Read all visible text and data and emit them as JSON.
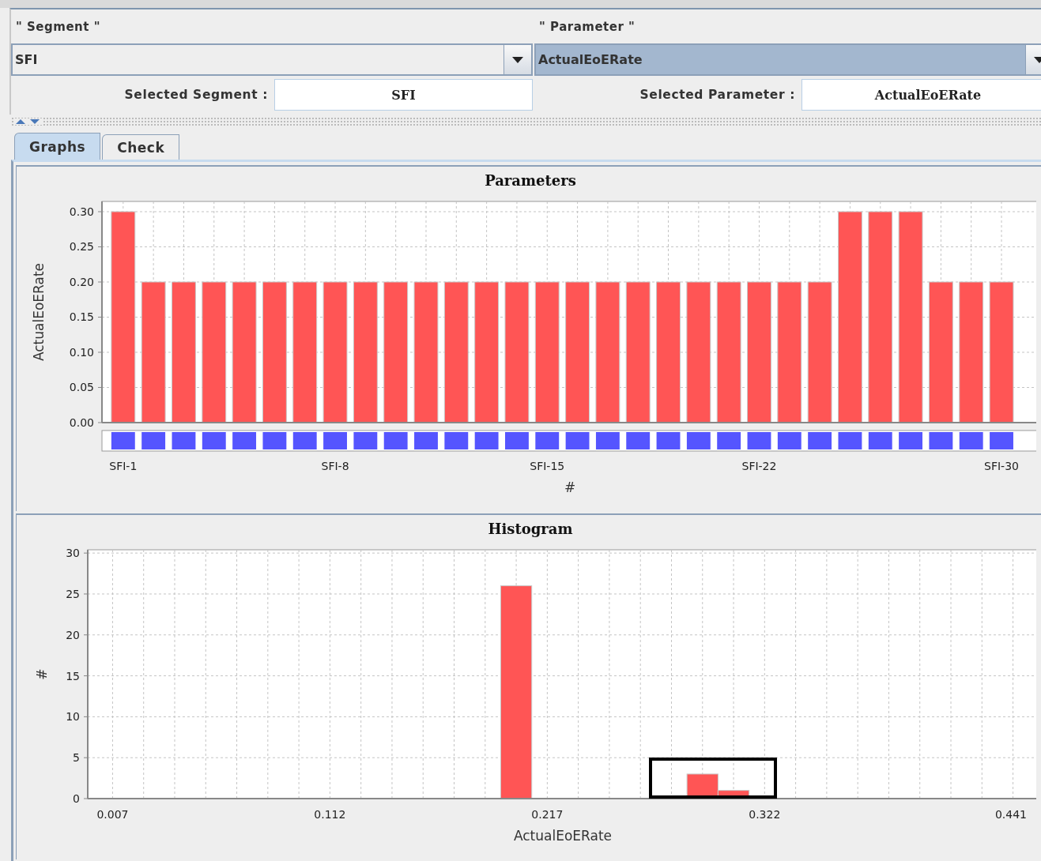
{
  "fields": [
    {
      "label": "\" Segment \"",
      "value": "SFI",
      "highlighted": false,
      "selected_label": "Selected Segment :",
      "selected_value": "SFI"
    },
    {
      "label": "\" Parameter \"",
      "value": "ActualEoERate",
      "highlighted": true,
      "selected_label": "Selected Parameter :",
      "selected_value": "ActualEoERate"
    }
  ],
  "tabs": [
    {
      "label": "Graphs",
      "selected": true
    },
    {
      "label": "Check",
      "selected": false
    }
  ],
  "charts": [
    {
      "chart_data": {
        "type": "bar",
        "title": "Parameters",
        "xlabel": "#",
        "ylabel": "ActualEoERate",
        "grid": true,
        "categories": [
          "SFI-1",
          null,
          null,
          null,
          null,
          null,
          null,
          "SFI-8",
          null,
          null,
          null,
          null,
          null,
          null,
          "SFI-15",
          null,
          null,
          null,
          null,
          null,
          null,
          "SFI-22",
          null,
          null,
          null,
          null,
          null,
          null,
          null,
          "SFI-30"
        ],
        "series": [
          {
            "color": "#ff5555",
            "values": [
              0.3,
              0.2,
              0.2,
              0.2,
              0.2,
              0.2,
              0.2,
              0.2,
              0.2,
              0.2,
              0.2,
              0.2,
              0.2,
              0.2,
              0.2,
              0.2,
              0.2,
              0.2,
              0.2,
              0.2,
              0.2,
              0.2,
              0.2,
              0.2,
              0.3,
              0.3,
              0.3,
              0.2,
              0.2,
              0.2
            ]
          }
        ],
        "ylim": [
          0,
          0.3146
        ],
        "yticks": [
          {
            "value": 0,
            "label": "0.00"
          },
          {
            "value": 0.05,
            "label": "0.05"
          },
          {
            "value": 0.1,
            "label": "0.10"
          },
          {
            "value": 0.15,
            "label": "0.15"
          },
          {
            "value": 0.2,
            "label": "0.20"
          },
          {
            "value": 0.25,
            "label": "0.25"
          },
          {
            "value": 0.3,
            "label": "0.30"
          }
        ]
      }
    },
    {
      "chart_data": {
        "type": "bar",
        "title": "Histogram",
        "xlabel": "ActualEoERate",
        "ylabel": "#",
        "grid": true,
        "x": [
          0.202,
          0.292,
          0.307
        ],
        "series": [
          {
            "color": "#ff5555",
            "values": [
              26,
              3,
              1
            ]
          }
        ],
        "xlim": [
          -0.005,
          0.454
        ],
        "ylim": [
          0,
          30.4
        ],
        "xticks": [
          0.007,
          0.112,
          0.217,
          0.322,
          0.441
        ],
        "yticks": [
          0,
          5,
          10,
          15,
          20,
          25,
          30
        ]
      }
    }
  ]
}
